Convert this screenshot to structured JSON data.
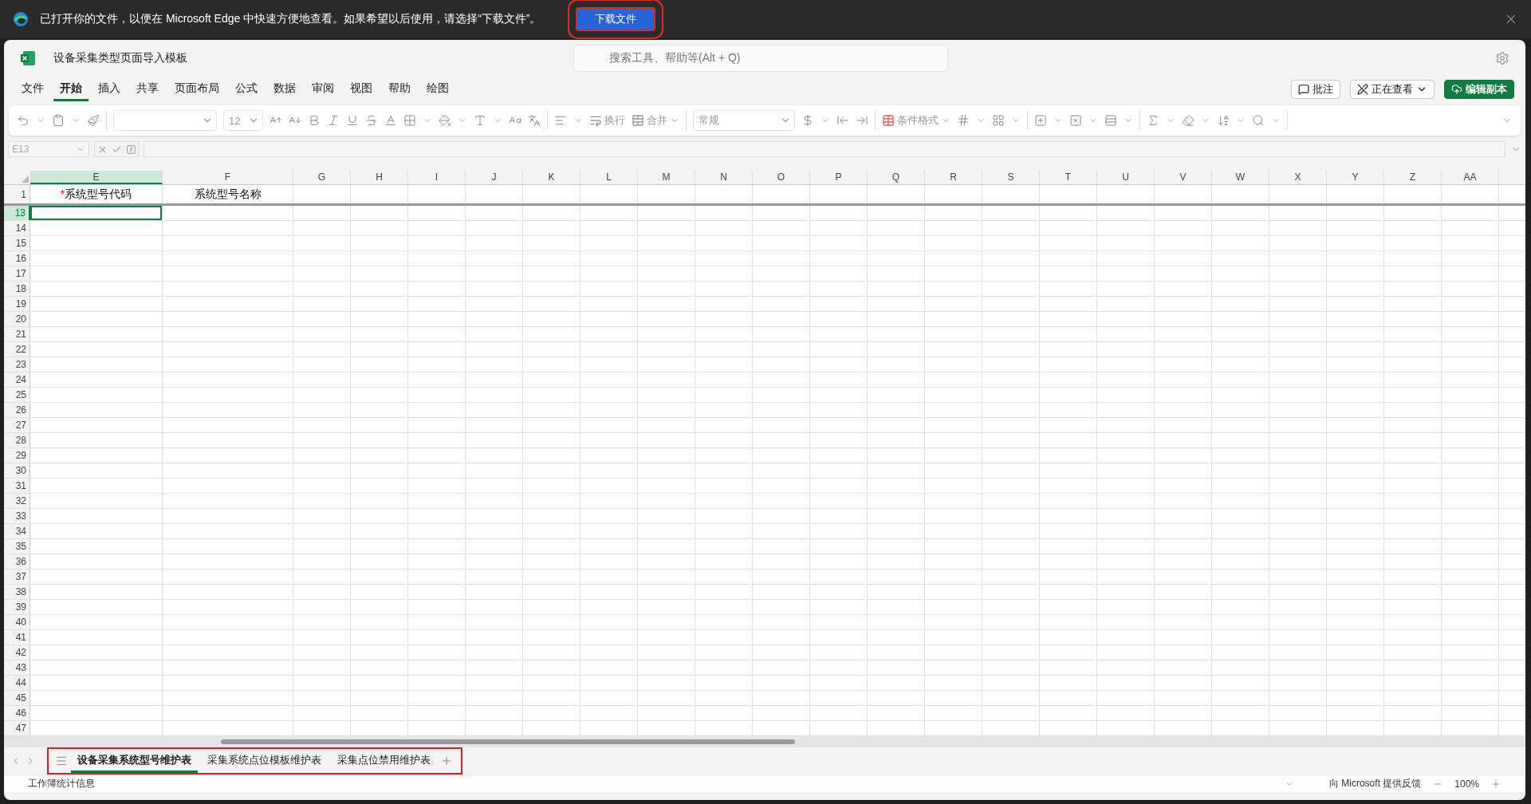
{
  "banner": {
    "message": "已打开你的文件，以便在 Microsoft Edge 中快速方便地查看。如果希望以后使用，请选择“下载文件”。",
    "button": "下载文件"
  },
  "window": {
    "title": "设备采集类型页面导入模板"
  },
  "search": {
    "placeholder": "搜索工具、帮助等(Alt + Q)"
  },
  "menu_tabs": [
    {
      "label": "文件",
      "selected": false
    },
    {
      "label": "开始",
      "selected": true
    },
    {
      "label": "插入",
      "selected": false
    },
    {
      "label": "共享",
      "selected": false
    },
    {
      "label": "页面布局",
      "selected": false
    },
    {
      "label": "公式",
      "selected": false
    },
    {
      "label": "数据",
      "selected": false
    },
    {
      "label": "审阅",
      "selected": false
    },
    {
      "label": "视图",
      "selected": false
    },
    {
      "label": "帮助",
      "selected": false
    },
    {
      "label": "绘图",
      "selected": false
    }
  ],
  "actions": {
    "comments": "批注",
    "viewing": "正在查看",
    "edit_copy": "编辑副本"
  },
  "toolbar": {
    "font_size": "12",
    "wrap": "换行",
    "merge": "合并",
    "number_format": "常规",
    "conditional_format": "条件格式"
  },
  "formula_bar": {
    "name_box": "E13"
  },
  "columns": [
    {
      "label": "E",
      "selected": true
    },
    {
      "label": "F",
      "selected": false
    },
    {
      "label": "G",
      "selected": false
    },
    {
      "label": "H",
      "selected": false
    },
    {
      "label": "I",
      "selected": false
    },
    {
      "label": "J",
      "selected": false
    },
    {
      "label": "K",
      "selected": false
    },
    {
      "label": "L",
      "selected": false
    },
    {
      "label": "M",
      "selected": false
    },
    {
      "label": "N",
      "selected": false
    },
    {
      "label": "O",
      "selected": false
    },
    {
      "label": "P",
      "selected": false
    },
    {
      "label": "Q",
      "selected": false
    },
    {
      "label": "R",
      "selected": false
    },
    {
      "label": "S",
      "selected": false
    },
    {
      "label": "T",
      "selected": false
    },
    {
      "label": "U",
      "selected": false
    },
    {
      "label": "V",
      "selected": false
    },
    {
      "label": "W",
      "selected": false
    },
    {
      "label": "X",
      "selected": false
    },
    {
      "label": "Y",
      "selected": false
    },
    {
      "label": "Z",
      "selected": false
    },
    {
      "label": "AA",
      "selected": false
    }
  ],
  "rows": [
    {
      "number": "1",
      "selected": false,
      "cells": [
        {
          "mark": "*",
          "text": "系统型号代码"
        },
        {
          "text": "系统型号名称"
        }
      ]
    },
    {
      "number": "13",
      "selected": true
    },
    {
      "number": "14",
      "selected": false
    },
    {
      "number": "15",
      "selected": false
    },
    {
      "number": "16",
      "selected": false
    },
    {
      "number": "17",
      "selected": false
    },
    {
      "number": "18",
      "selected": false
    },
    {
      "number": "19",
      "selected": false
    },
    {
      "number": "20",
      "selected": false
    },
    {
      "number": "21",
      "selected": false
    },
    {
      "number": "22",
      "selected": false
    },
    {
      "number": "23",
      "selected": false
    },
    {
      "number": "24",
      "selected": false
    },
    {
      "number": "25",
      "selected": false
    },
    {
      "number": "26",
      "selected": false
    },
    {
      "number": "27",
      "selected": false
    },
    {
      "number": "28",
      "selected": false
    },
    {
      "number": "29",
      "selected": false
    },
    {
      "number": "30",
      "selected": false
    },
    {
      "number": "31",
      "selected": false
    },
    {
      "number": "32",
      "selected": false
    },
    {
      "number": "33",
      "selected": false
    },
    {
      "number": "34",
      "selected": false
    },
    {
      "number": "35",
      "selected": false
    },
    {
      "number": "36",
      "selected": false
    },
    {
      "number": "37",
      "selected": false
    },
    {
      "number": "38",
      "selected": false
    },
    {
      "number": "39",
      "selected": false
    },
    {
      "number": "40",
      "selected": false
    },
    {
      "number": "41",
      "selected": false
    },
    {
      "number": "42",
      "selected": false
    },
    {
      "number": "43",
      "selected": false
    },
    {
      "number": "44",
      "selected": false
    },
    {
      "number": "45",
      "selected": false
    },
    {
      "number": "46",
      "selected": false
    },
    {
      "number": "47",
      "selected": false
    }
  ],
  "sheet_tabs": [
    {
      "label": "设备采集系统型号维护表",
      "selected": true
    },
    {
      "label": "采集系统点位模板维护表",
      "selected": false
    },
    {
      "label": "采集点位禁用维护表",
      "selected": false
    }
  ],
  "status_bar": {
    "stats": "工作簿统计信息",
    "feedback": "向 Microsoft 提供反馈",
    "zoom": "100%"
  }
}
